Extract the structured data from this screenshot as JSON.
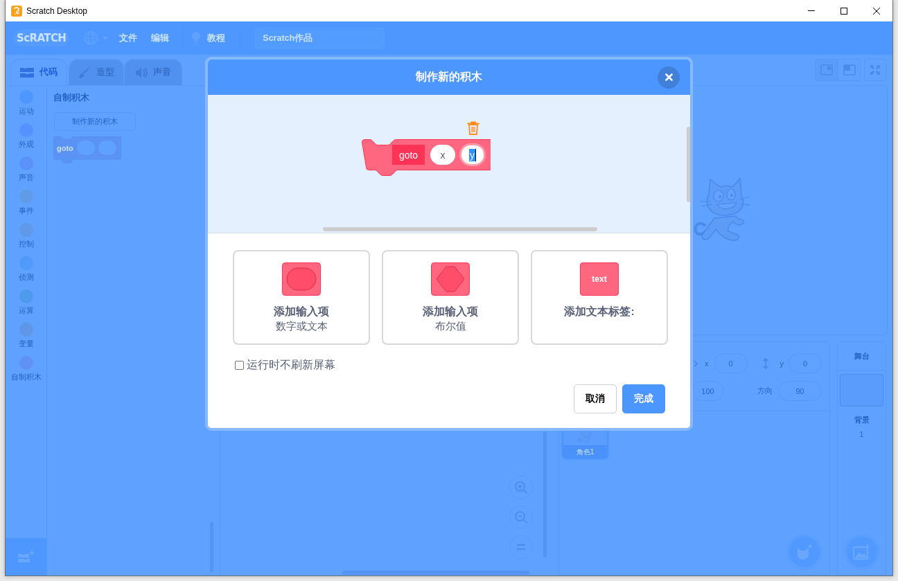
{
  "window": {
    "title": "Scratch Desktop"
  },
  "menu_bar": {
    "logo": "ScRATCH",
    "menus": [
      "文件",
      "编辑"
    ],
    "tutorials": "教程",
    "project_title": "Scratch作品"
  },
  "editor_tabs": [
    {
      "label": "代码",
      "kind": "code",
      "selected": true
    },
    {
      "label": "造型",
      "kind": "costumes",
      "selected": false
    },
    {
      "label": "声音",
      "kind": "sounds",
      "selected": false
    }
  ],
  "categories": [
    {
      "label": "运动",
      "color": "#4d97ff"
    },
    {
      "label": "外观",
      "color": "#5592ff"
    },
    {
      "label": "声音",
      "color": "#5a92fa"
    },
    {
      "label": "事件",
      "color": "#5f9be6"
    },
    {
      "label": "控制",
      "color": "#5f99e8"
    },
    {
      "label": "侦测",
      "color": "#4f9afb"
    },
    {
      "label": "运算",
      "color": "#4e9bee"
    },
    {
      "label": "变量",
      "color": "#5f96e8"
    },
    {
      "label": "自制积木",
      "color": "#5f92f2"
    }
  ],
  "palette": {
    "heading": "自制积木",
    "make_block_button": "制作新的积木",
    "block_label": "goto"
  },
  "sprite_info": {
    "x_label": "x",
    "x_value": "0",
    "y_label": "y",
    "y_value": "0",
    "size_value": "100",
    "direction_label": "方向",
    "direction_value": "90"
  },
  "sprites": [
    {
      "name": "角色1",
      "selected": true
    }
  ],
  "stage_selector": {
    "heading": "舞台",
    "backdrops_label": "背景",
    "backdrop_count": "1"
  },
  "dialog": {
    "title": "制作新的积木",
    "block": {
      "label": "goto",
      "inputs": [
        {
          "text": "x",
          "editing": false
        },
        {
          "text": "y",
          "editing": true
        }
      ]
    },
    "options": [
      {
        "kind": "number_text",
        "title": "添加输入项",
        "subtitle": "数字或文本"
      },
      {
        "kind": "boolean",
        "title": "添加输入项",
        "subtitle": "布尔值"
      },
      {
        "kind": "label",
        "title": "添加文本标签:",
        "icon_text": "text"
      }
    ],
    "run_without_refresh": {
      "label": "运行时不刷新屏幕",
      "checked": false
    },
    "buttons": [
      {
        "label": "取消",
        "kind": "cancel"
      },
      {
        "label": "完成",
        "kind": "confirm"
      }
    ]
  }
}
